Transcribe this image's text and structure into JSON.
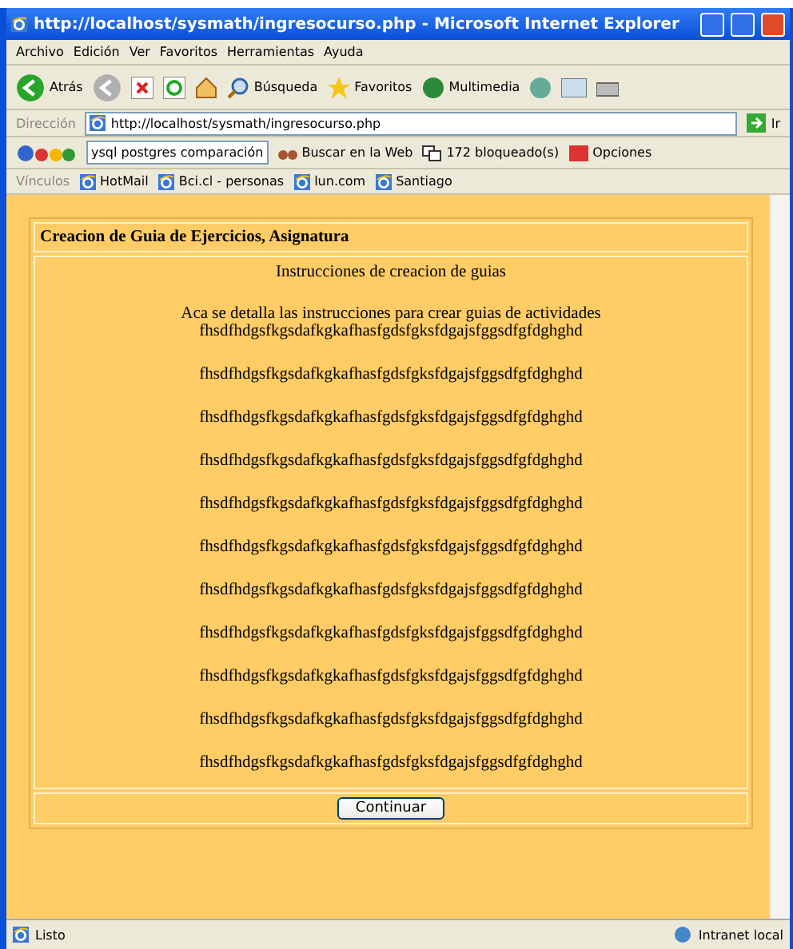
{
  "window": {
    "title": "http://localhost/sysmath/ingresocurso.php - Microsoft Internet Explorer"
  },
  "menu": [
    "Archivo",
    "Edición",
    "Ver",
    "Favoritos",
    "Herramientas",
    "Ayuda"
  ],
  "toolbar": {
    "back": "Atrás",
    "search": "Búsqueda",
    "favorites": "Favoritos",
    "media": "Multimedia"
  },
  "address": {
    "label": "Dirección",
    "value": "http://localhost/sysmath/ingresocurso.php",
    "go": "Ir"
  },
  "google": {
    "query": "ysql postgres comparación",
    "search": "Buscar en la Web",
    "blocked": "172 bloqueado(s)",
    "options": "Opciones"
  },
  "links": {
    "label": "Vínculos",
    "items": [
      "HotMail",
      "Bci.cl - personas",
      "lun.com",
      "Santiago"
    ]
  },
  "page": {
    "heading": "Creacion de Guia de Ejercicios, Asignatura",
    "subtitle": "Instrucciones de creacion de guias",
    "intro": "Aca se detalla las instrucciones para crear guias de actividades",
    "lines": [
      "fhsdfhdgsfkgsdafkgkafhasfgdsfgksfdgajsfggsdfgfdghghd",
      "fhsdfhdgsfkgsdafkgkafhasfgdsfgksfdgajsfggsdfgfdghghd",
      "fhsdfhdgsfkgsdafkgkafhasfgdsfgksfdgajsfggsdfgfdghghd",
      "fhsdfhdgsfkgsdafkgkafhasfgdsfgksfdgajsfggsdfgfdghghd",
      "fhsdfhdgsfkgsdafkgkafhasfgdsfgksfdgajsfggsdfgfdghghd",
      "fhsdfhdgsfkgsdafkgkafhasfgdsfgksfdgajsfggsdfgfdghghd",
      "fhsdfhdgsfkgsdafkgkafhasfgdsfgksfdgajsfggsdfgfdghghd",
      "fhsdfhdgsfkgsdafkgkafhasfgdsfgksfdgajsfggsdfgfdghghd",
      "fhsdfhdgsfkgsdafkgkafhasfgdsfgksfdgajsfggsdfgfdghghd",
      "fhsdfhdgsfkgsdafkgkafhasfgdsfgksfdgajsfggsdfgfdghghd",
      "fhsdfhdgsfkgsdafkgkafhasfgdsfgksfdgajsfggsdfgfdghghd"
    ],
    "button": "Continuar"
  },
  "status_bar": {
    "text": "Listo",
    "zone": "Intranet local"
  }
}
